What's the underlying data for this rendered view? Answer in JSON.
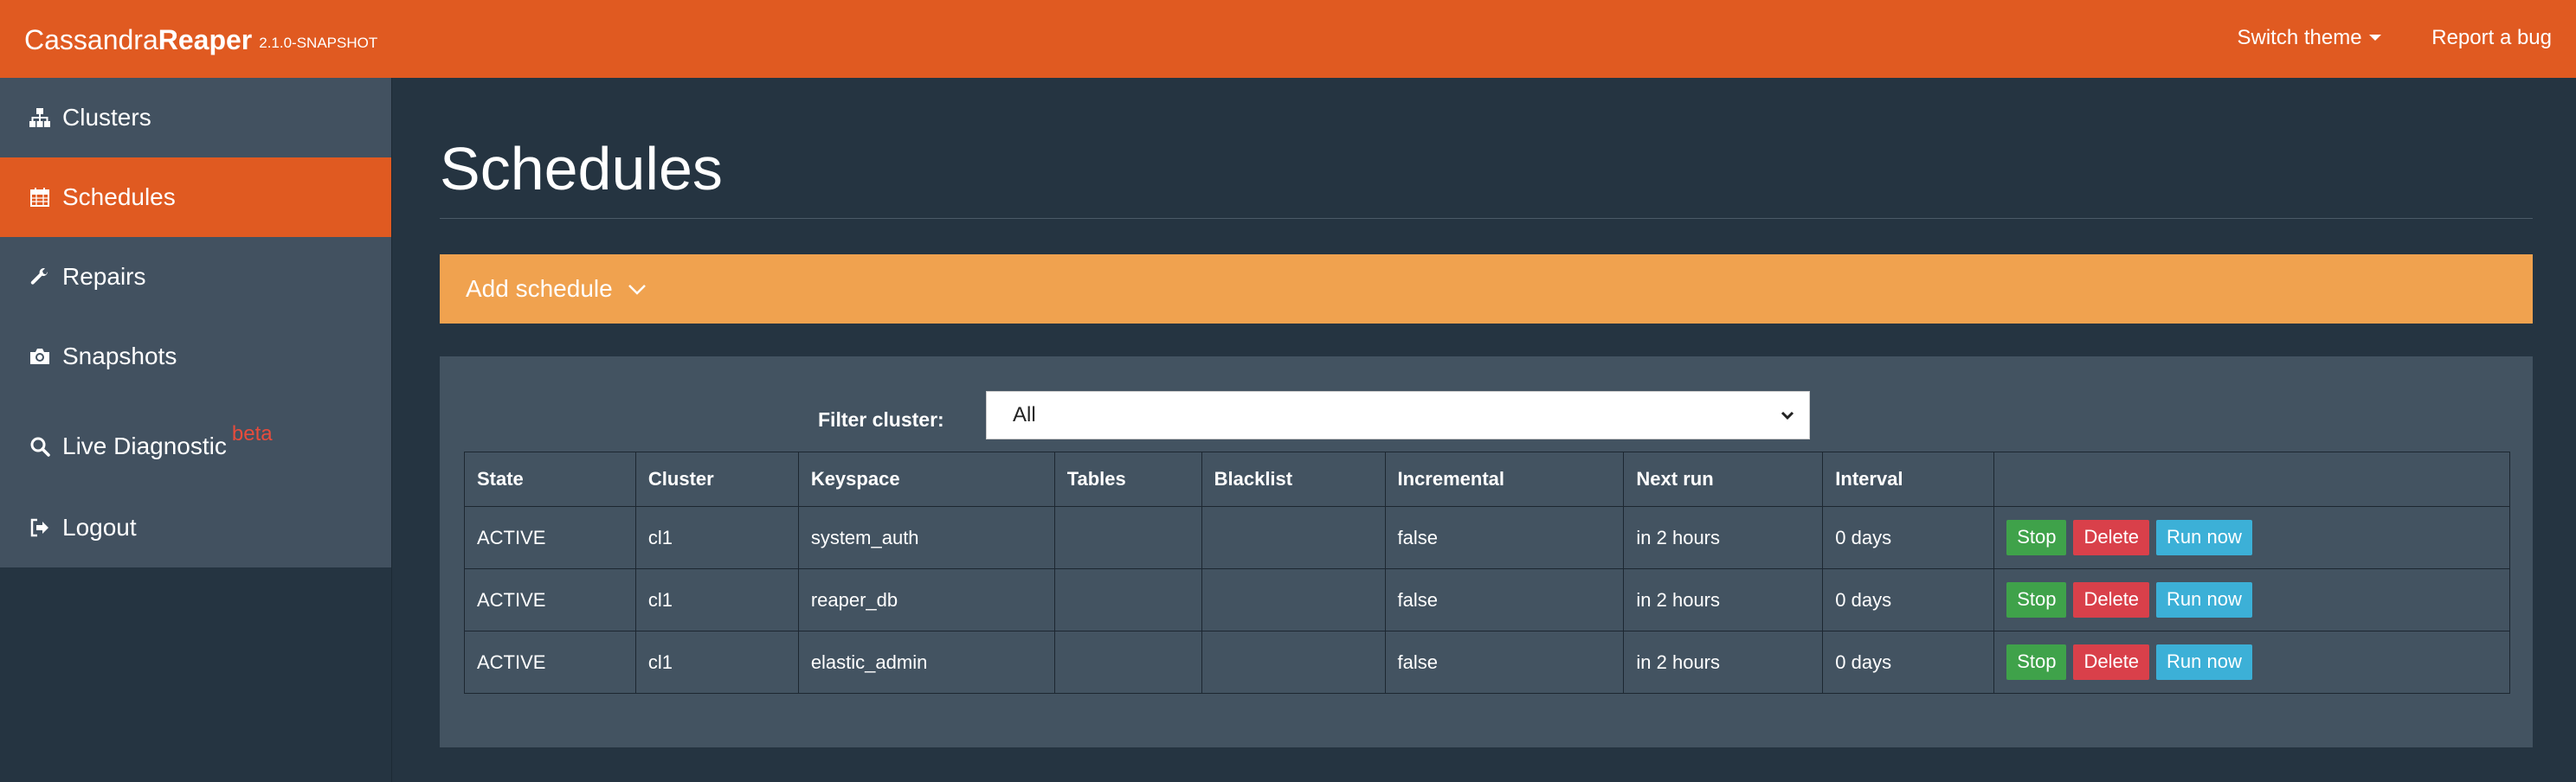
{
  "navbar": {
    "brand_light": "Cassandra",
    "brand_bold": "Reaper",
    "version": "2.1.0-SNAPSHOT",
    "switch_theme": "Switch theme",
    "report_bug": "Report a bug"
  },
  "sidebar": {
    "items": [
      {
        "label": "Clusters",
        "icon": "sitemap-icon"
      },
      {
        "label": "Schedules",
        "icon": "calendar-icon",
        "active": true
      },
      {
        "label": "Repairs",
        "icon": "wrench-icon"
      },
      {
        "label": "Snapshots",
        "icon": "camera-icon"
      },
      {
        "label": "Live Diagnostic",
        "icon": "search-icon",
        "badge": "beta"
      },
      {
        "label": "Logout",
        "icon": "logout-icon"
      }
    ]
  },
  "main": {
    "title": "Schedules",
    "add_schedule": "Add schedule",
    "filter_label": "Filter cluster:",
    "filter_value": "All",
    "columns": [
      "State",
      "Cluster",
      "Keyspace",
      "Tables",
      "Blacklist",
      "Incremental",
      "Next run",
      "Interval",
      ""
    ],
    "rows": [
      {
        "state": "ACTIVE",
        "cluster": "cl1",
        "keyspace": "system_auth",
        "tables": "",
        "blacklist": "",
        "incremental": "false",
        "next_run": "in 2 hours",
        "interval": "0 days"
      },
      {
        "state": "ACTIVE",
        "cluster": "cl1",
        "keyspace": "reaper_db",
        "tables": "",
        "blacklist": "",
        "incremental": "false",
        "next_run": "in 2 hours",
        "interval": "0 days"
      },
      {
        "state": "ACTIVE",
        "cluster": "cl1",
        "keyspace": "elastic_admin",
        "tables": "",
        "blacklist": "",
        "incremental": "false",
        "next_run": "in 2 hours",
        "interval": "0 days"
      }
    ],
    "buttons": {
      "stop": "Stop",
      "delete": "Delete",
      "run_now": "Run now"
    }
  },
  "colors": {
    "navbar": "#e05a21",
    "background": "#253441",
    "sidebar_item": "#425160",
    "add_panel": "#f0a24f",
    "stop": "#3fa24a",
    "delete": "#d9404a",
    "run_now": "#3cb0d7"
  }
}
